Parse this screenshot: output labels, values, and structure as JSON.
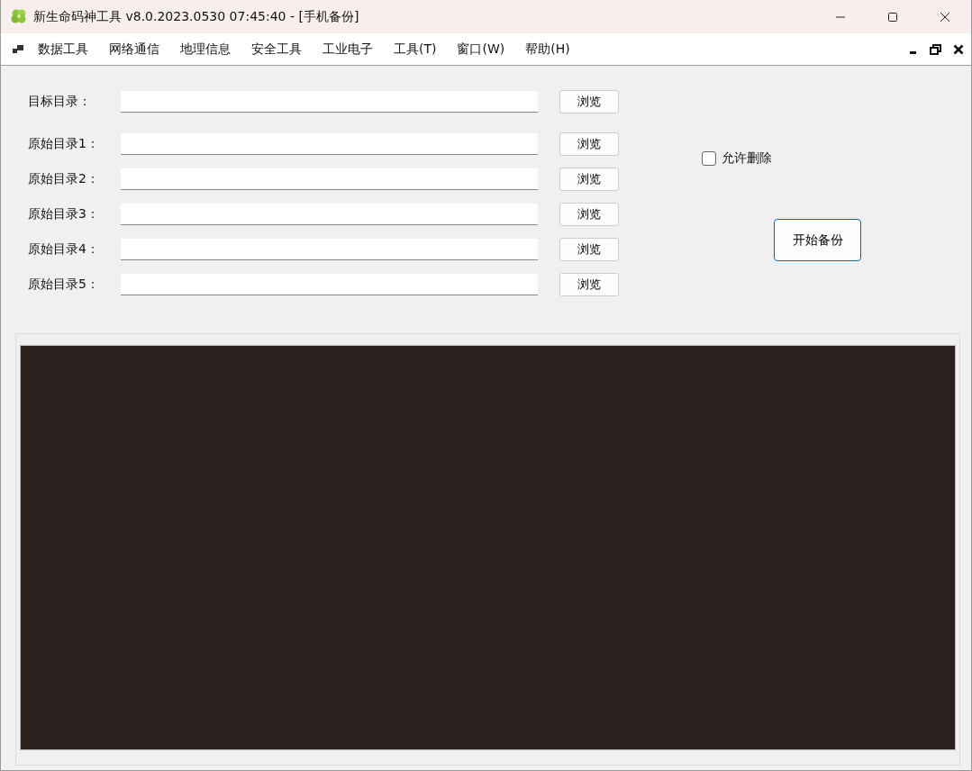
{
  "window": {
    "title": "新生命码神工具 v8.0.2023.0530 07:45:40 - [手机备份]"
  },
  "menu": [
    "数据工具",
    "网络通信",
    "地理信息",
    "安全工具",
    "工业电子",
    "工具(T)",
    "窗口(W)",
    "帮助(H)"
  ],
  "target": {
    "label": "目标目录：",
    "button": "浏览"
  },
  "sources": [
    {
      "label": "原始目录1：",
      "button": "浏览"
    },
    {
      "label": "原始目录2：",
      "button": "浏览"
    },
    {
      "label": "原始目录3：",
      "button": "浏览"
    },
    {
      "label": "原始目录4：",
      "button": "浏览"
    },
    {
      "label": "原始目录5：",
      "button": "浏览"
    }
  ],
  "allow_delete": {
    "label": "允许删除",
    "checked": false
  },
  "start_button": "开始备份"
}
